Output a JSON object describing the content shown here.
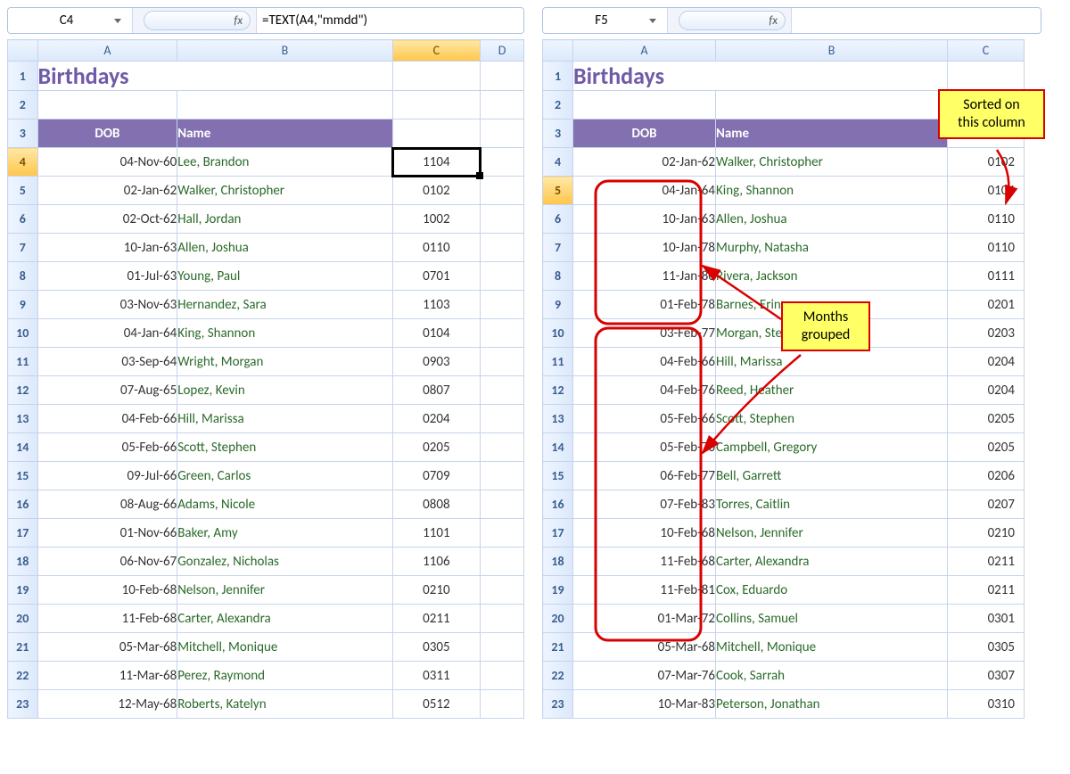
{
  "left": {
    "namebox": "C4",
    "fx_label": "fx",
    "formula": "=TEXT(A4,\"mmdd\")",
    "colHeaders": [
      "A",
      "B",
      "C",
      "D"
    ],
    "title": "Birthdays",
    "tableHeader": {
      "dob": "DOB",
      "name": "Name"
    },
    "selectedRow": 4,
    "selectedCol": "C",
    "rows": [
      {
        "n": 4,
        "dob": "04-Nov-60",
        "name": "Lee, Brandon",
        "c": "1104"
      },
      {
        "n": 5,
        "dob": "02-Jan-62",
        "name": "Walker, Christopher",
        "c": "0102"
      },
      {
        "n": 6,
        "dob": "02-Oct-62",
        "name": "Hall, Jordan",
        "c": "1002"
      },
      {
        "n": 7,
        "dob": "10-Jan-63",
        "name": "Allen, Joshua",
        "c": "0110"
      },
      {
        "n": 8,
        "dob": "01-Jul-63",
        "name": "Young, Paul",
        "c": "0701"
      },
      {
        "n": 9,
        "dob": "03-Nov-63",
        "name": "Hernandez, Sara",
        "c": "1103"
      },
      {
        "n": 10,
        "dob": "04-Jan-64",
        "name": "King, Shannon",
        "c": "0104"
      },
      {
        "n": 11,
        "dob": "03-Sep-64",
        "name": "Wright, Morgan",
        "c": "0903"
      },
      {
        "n": 12,
        "dob": "07-Aug-65",
        "name": "Lopez, Kevin",
        "c": "0807"
      },
      {
        "n": 13,
        "dob": "04-Feb-66",
        "name": "Hill, Marissa",
        "c": "0204"
      },
      {
        "n": 14,
        "dob": "05-Feb-66",
        "name": "Scott, Stephen",
        "c": "0205"
      },
      {
        "n": 15,
        "dob": "09-Jul-66",
        "name": "Green, Carlos",
        "c": "0709"
      },
      {
        "n": 16,
        "dob": "08-Aug-66",
        "name": "Adams, Nicole",
        "c": "0808"
      },
      {
        "n": 17,
        "dob": "01-Nov-66",
        "name": "Baker, Amy",
        "c": "1101"
      },
      {
        "n": 18,
        "dob": "06-Nov-67",
        "name": "Gonzalez, Nicholas",
        "c": "1106"
      },
      {
        "n": 19,
        "dob": "10-Feb-68",
        "name": "Nelson, Jennifer",
        "c": "0210"
      },
      {
        "n": 20,
        "dob": "11-Feb-68",
        "name": "Carter, Alexandra",
        "c": "0211"
      },
      {
        "n": 21,
        "dob": "05-Mar-68",
        "name": "Mitchell, Monique",
        "c": "0305"
      },
      {
        "n": 22,
        "dob": "11-Mar-68",
        "name": "Perez, Raymond",
        "c": "0311"
      },
      {
        "n": 23,
        "dob": "12-May-68",
        "name": "Roberts, Katelyn",
        "c": "0512"
      }
    ]
  },
  "right": {
    "namebox": "F5",
    "fx_label": "fx",
    "formula": "",
    "colHeaders": [
      "A",
      "B",
      "C"
    ],
    "title": "Birthdays",
    "tableHeader": {
      "dob": "DOB",
      "name": "Name"
    },
    "selectedRow": 5,
    "rows": [
      {
        "n": 4,
        "dob": "02-Jan-62",
        "name": "Walker, Christopher",
        "c": "0102"
      },
      {
        "n": 5,
        "dob": "04-Jan-64",
        "name": "King, Shannon",
        "c": "0104"
      },
      {
        "n": 6,
        "dob": "10-Jan-63",
        "name": "Allen, Joshua",
        "c": "0110"
      },
      {
        "n": 7,
        "dob": "10-Jan-78",
        "name": "Murphy, Natasha",
        "c": "0110"
      },
      {
        "n": 8,
        "dob": "11-Jan-80",
        "name": "Rivera, Jackson",
        "c": "0111"
      },
      {
        "n": 9,
        "dob": "01-Feb-78",
        "name": "Barnes, Erin",
        "c": "0201"
      },
      {
        "n": 10,
        "dob": "03-Feb-77",
        "name": "Morgan, Steven",
        "c": "0203"
      },
      {
        "n": 11,
        "dob": "04-Feb-66",
        "name": "Hill, Marissa",
        "c": "0204"
      },
      {
        "n": 12,
        "dob": "04-Feb-76",
        "name": "Reed, Heather",
        "c": "0204"
      },
      {
        "n": 13,
        "dob": "05-Feb-66",
        "name": "Scott, Stephen",
        "c": "0205"
      },
      {
        "n": 14,
        "dob": "05-Feb-70",
        "name": "Campbell, Gregory",
        "c": "0205"
      },
      {
        "n": 15,
        "dob": "06-Feb-77",
        "name": "Bell, Garrett",
        "c": "0206"
      },
      {
        "n": 16,
        "dob": "07-Feb-83",
        "name": "Torres, Caitlin",
        "c": "0207"
      },
      {
        "n": 17,
        "dob": "10-Feb-68",
        "name": "Nelson, Jennifer",
        "c": "0210"
      },
      {
        "n": 18,
        "dob": "11-Feb-68",
        "name": "Carter, Alexandra",
        "c": "0211"
      },
      {
        "n": 19,
        "dob": "11-Feb-81",
        "name": "Cox, Eduardo",
        "c": "0211"
      },
      {
        "n": 20,
        "dob": "01-Mar-72",
        "name": "Collins, Samuel",
        "c": "0301"
      },
      {
        "n": 21,
        "dob": "05-Mar-68",
        "name": "Mitchell, Monique",
        "c": "0305"
      },
      {
        "n": 22,
        "dob": "07-Mar-76",
        "name": "Cook, Sarrah",
        "c": "0307"
      },
      {
        "n": 23,
        "dob": "10-Mar-83",
        "name": "Peterson, Jonathan",
        "c": "0310"
      }
    ]
  },
  "callouts": {
    "sorted": "Sorted on\nthis column",
    "grouped": "Months\ngrouped"
  }
}
